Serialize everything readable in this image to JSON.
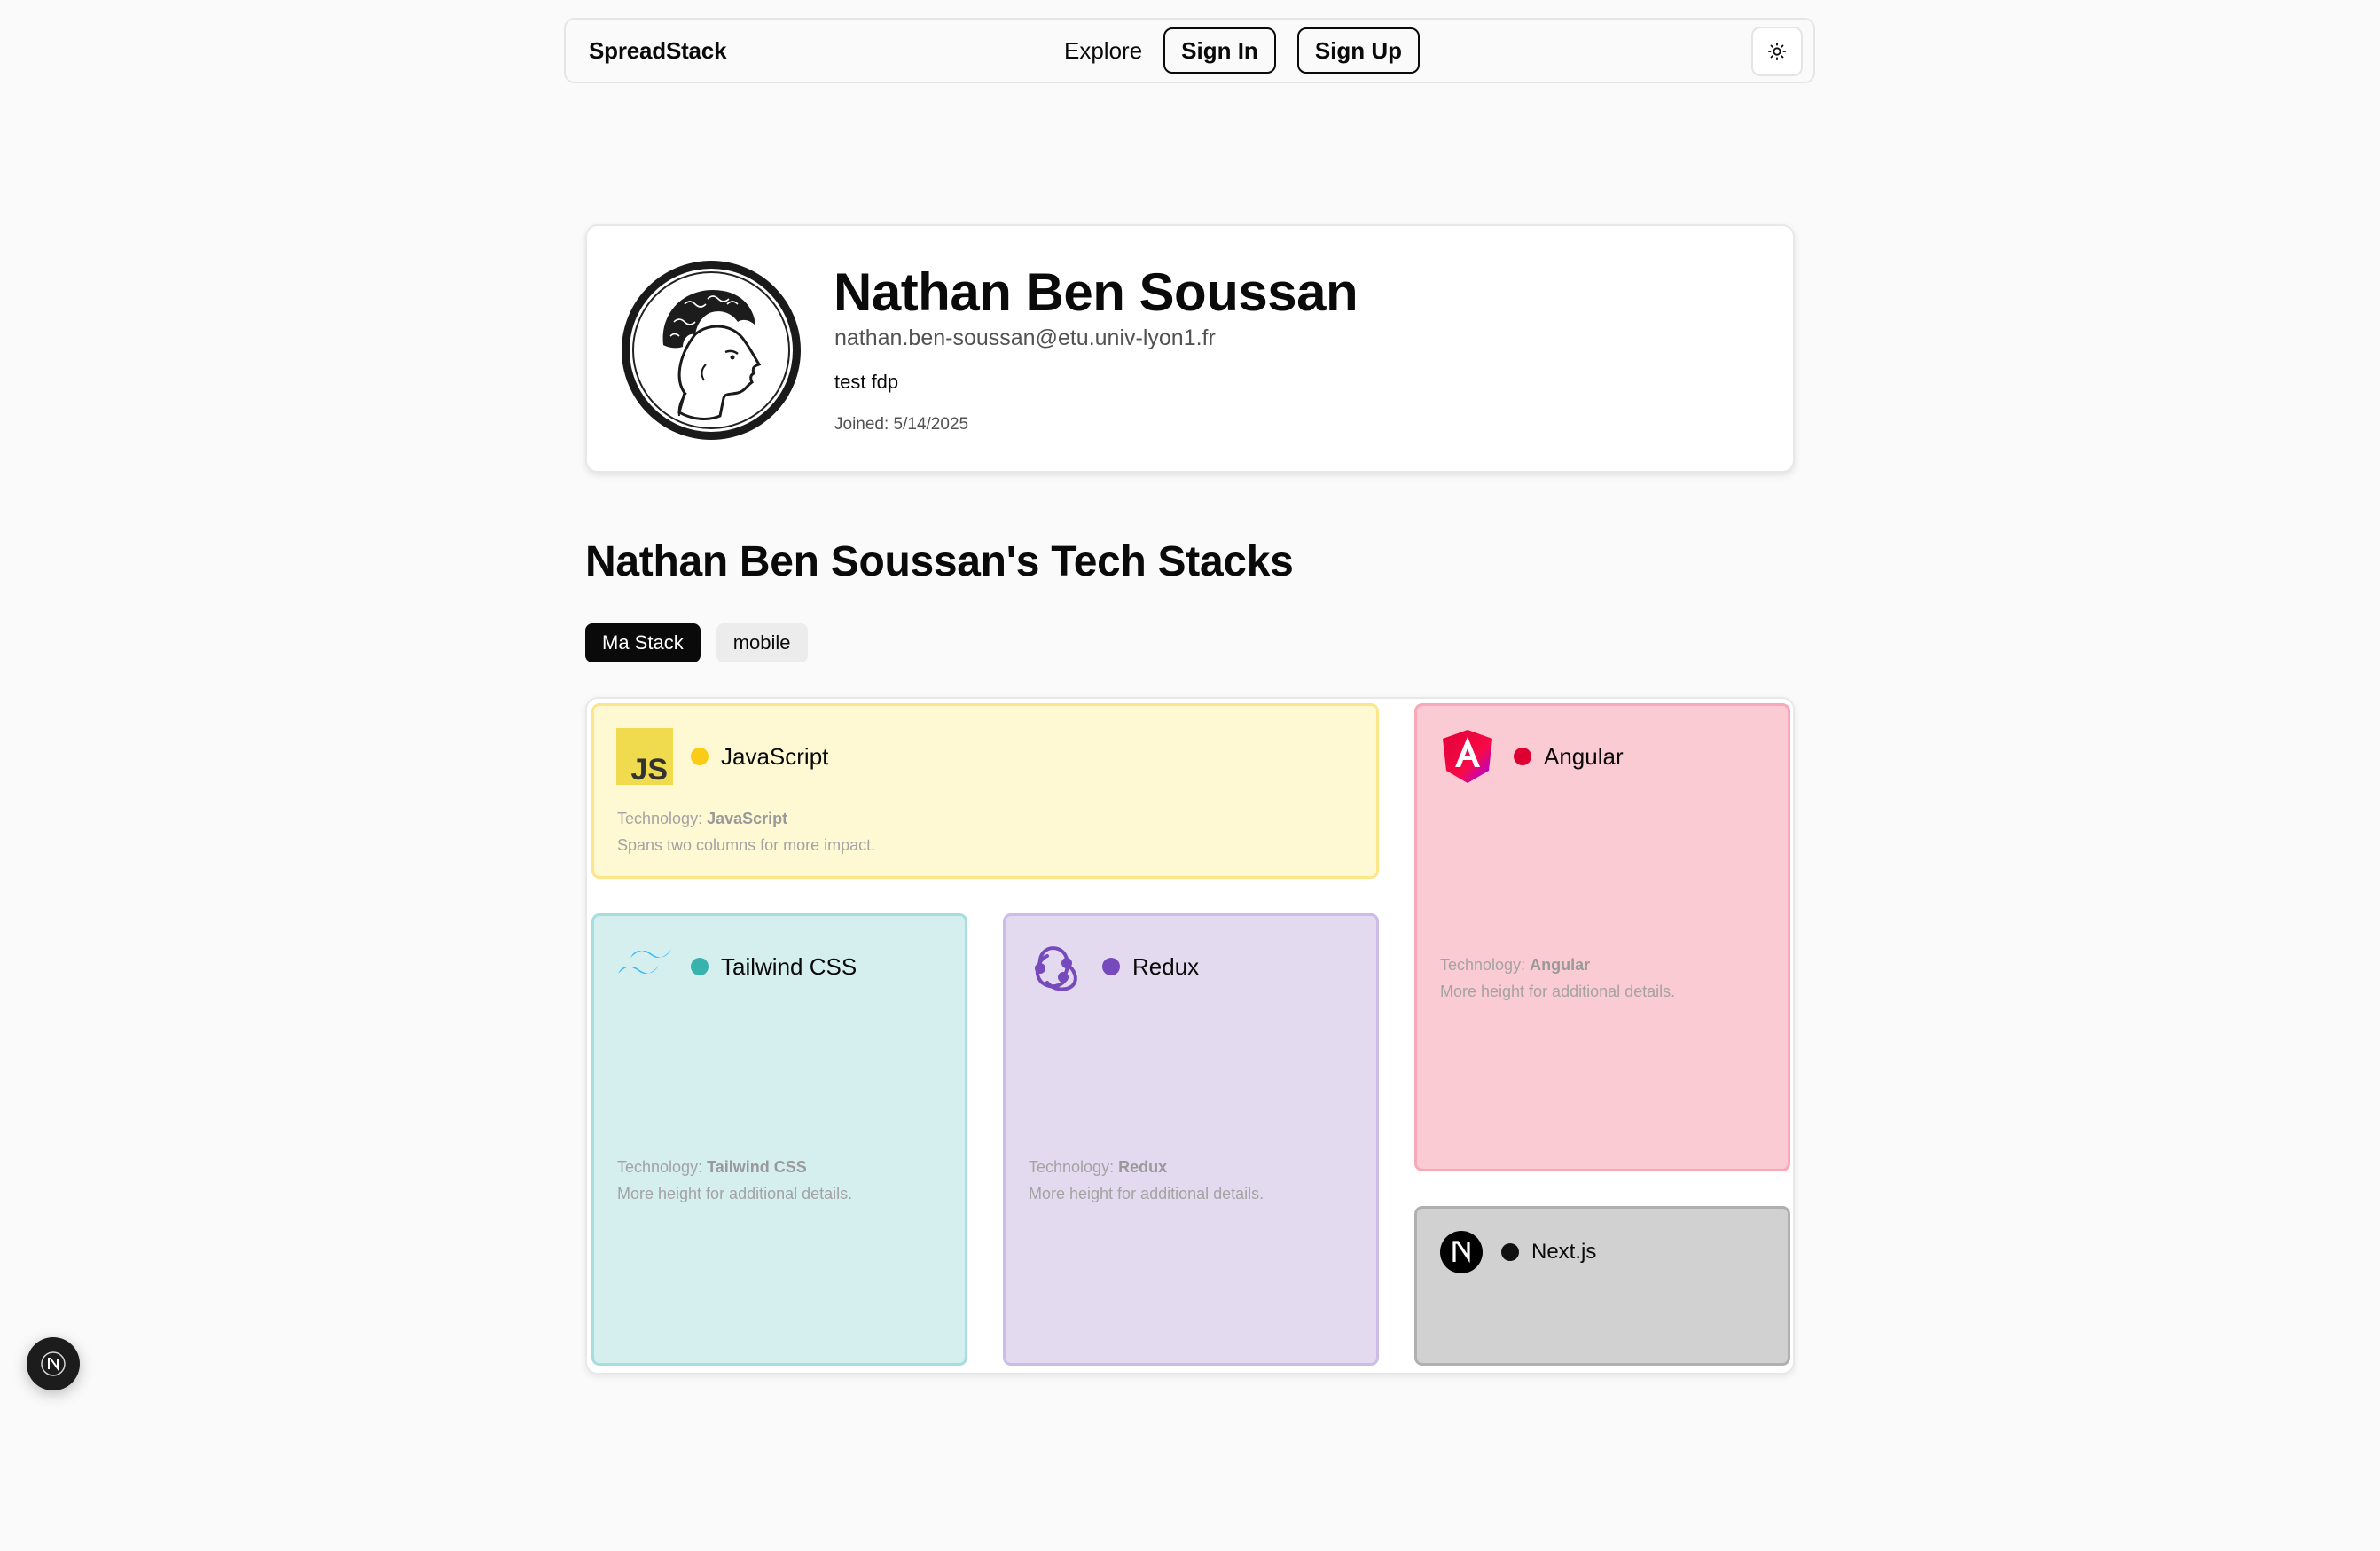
{
  "navbar": {
    "brand": "SpreadStack",
    "explore": "Explore",
    "sign_in": "Sign In",
    "sign_up": "Sign Up",
    "theme_icon": "sun-icon"
  },
  "profile": {
    "name": "Nathan Ben Soussan",
    "email": "nathan.ben-soussan@etu.univ-lyon1.fr",
    "bio": "test fdp",
    "joined": "Joined: 5/14/2025",
    "avatar_icon": "profile-portrait"
  },
  "stacks_section": {
    "title": "Nathan Ben Soussan's Tech Stacks",
    "tabs": [
      {
        "label": "Ma Stack",
        "active": true
      },
      {
        "label": "mobile",
        "active": false
      }
    ]
  },
  "cards": {
    "javascript": {
      "name": "JavaScript",
      "tech_prefix": "Technology: ",
      "tech": "JavaScript",
      "detail": "Spans two columns for more impact.",
      "dot_color": "#facc15",
      "bg_color": "#fef9d3",
      "border_color": "#fde68a",
      "icon": "javascript-logo"
    },
    "angular": {
      "name": "Angular",
      "tech_prefix": "Technology: ",
      "tech": "Angular",
      "detail": "More height for additional details.",
      "dot_color": "#dd0031",
      "bg_color": "#fbcbd4",
      "border_color": "#f9a8b8",
      "icon": "angular-logo"
    },
    "tailwind": {
      "name": "Tailwind CSS",
      "tech_prefix": "Technology: ",
      "tech": "Tailwind CSS",
      "detail": "More height for additional details.",
      "dot_color": "#38b2ac",
      "bg_color": "#d5eeee",
      "border_color": "#a5dede",
      "icon": "tailwind-logo"
    },
    "redux": {
      "name": "Redux",
      "tech_prefix": "Technology: ",
      "tech": "Redux",
      "detail": "More height for additional details.",
      "dot_color": "#764abc",
      "bg_color": "#e3daf0",
      "border_color": "#cdbbe8",
      "icon": "redux-logo"
    },
    "nextjs": {
      "name": "Next.js",
      "dot_color": "#111111",
      "bg_color": "#d1d1d1",
      "border_color": "#b0b0b0",
      "icon": "nextjs-logo"
    }
  },
  "dev_badge": {
    "label": "N"
  }
}
